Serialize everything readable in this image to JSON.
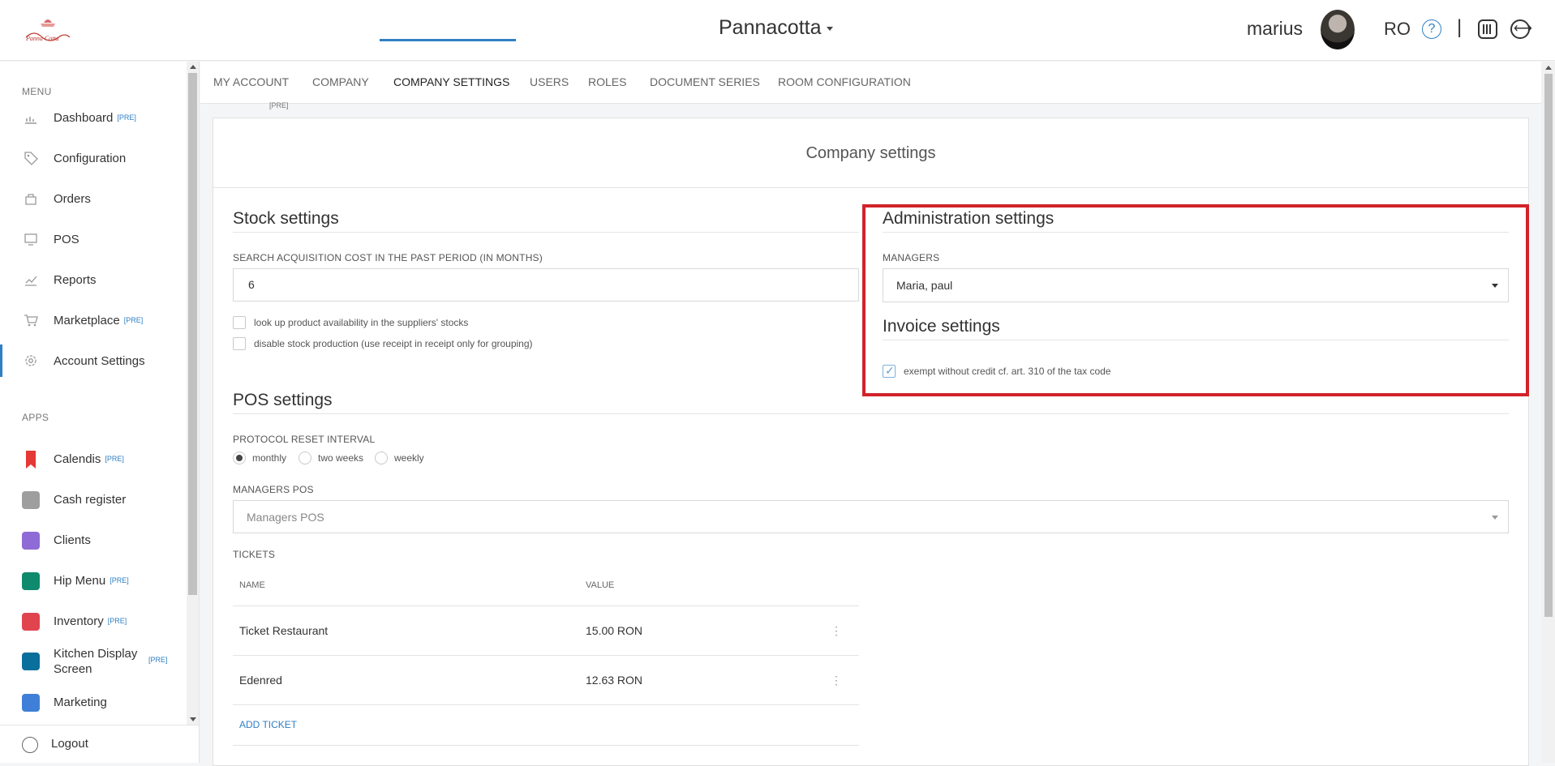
{
  "header": {
    "company": "Pannacotta",
    "username": "marius",
    "language": "RO",
    "help_glyph": "?",
    "separator": "|"
  },
  "sidebar": {
    "menu_title": "MENU",
    "apps_title": "APPS",
    "pre_badge": "[PRE]",
    "menu_items": [
      {
        "label": "Dashboard",
        "pre": true,
        "icon": "dashboard-icon"
      },
      {
        "label": "Configuration",
        "pre": false,
        "icon": "tag-icon"
      },
      {
        "label": "Orders",
        "pre": false,
        "icon": "orders-icon"
      },
      {
        "label": "POS",
        "pre": false,
        "icon": "pos-icon"
      },
      {
        "label": "Reports",
        "pre": false,
        "icon": "reports-icon"
      },
      {
        "label": "Marketplace",
        "pre": true,
        "icon": "cart-icon"
      },
      {
        "label": "Account Settings",
        "pre": false,
        "icon": "gear-icon"
      }
    ],
    "app_items": [
      {
        "label": "Calendis",
        "pre": true,
        "color": "#e53935"
      },
      {
        "label": "Cash register",
        "pre": false,
        "color": "#9e9e9e"
      },
      {
        "label": "Clients",
        "pre": false,
        "color": "#8e6bd6"
      },
      {
        "label": "Hip Menu",
        "pre": true,
        "color": "#0f8a6c"
      },
      {
        "label": "Inventory",
        "pre": true,
        "color": "#e0454f"
      },
      {
        "label": "Kitchen Display Screen",
        "pre": true,
        "color": "#0b6f9c"
      },
      {
        "label": "Marketing",
        "pre": false,
        "color": "#3f7fd8"
      }
    ],
    "logout": "Logout"
  },
  "tabs": {
    "items": [
      "MY ACCOUNT",
      "COMPANY",
      "COMPANY SETTINGS",
      "USERS",
      "ROLES",
      "DOCUMENT SERIES",
      "ROOM CONFIGURATION"
    ],
    "active": "COMPANY SETTINGS",
    "pre_badge": "[PRE]"
  },
  "card": {
    "title": "Company settings"
  },
  "stock": {
    "title": "Stock settings",
    "search_label": "SEARCH ACQUISITION COST IN THE PAST PERIOD (IN MONTHS)",
    "search_value": "6",
    "check_lookup": "look up product availability in the suppliers' stocks",
    "check_disable": "disable stock production (use receipt in receipt only for grouping)"
  },
  "admin": {
    "title": "Administration settings",
    "managers_label": "MANAGERS",
    "managers_value": "Maria, paul"
  },
  "invoice": {
    "title": "Invoice settings",
    "exempt_label": "exempt without credit cf. art. 310 of the tax code",
    "exempt_checked": true
  },
  "pos": {
    "title": "POS settings",
    "reset_label": "PROTOCOL RESET INTERVAL",
    "reset_options": [
      "monthly",
      "two weeks",
      "weekly"
    ],
    "reset_selected": "monthly",
    "managers_pos_label": "MANAGERS POS",
    "managers_pos_placeholder": "Managers POS",
    "tickets_label": "TICKETS",
    "tickets_columns": [
      "NAME",
      "VALUE"
    ],
    "tickets": [
      {
        "name": "Ticket Restaurant",
        "value": "15.00 RON"
      },
      {
        "name": "Edenred",
        "value": "12.63 RON"
      }
    ],
    "add_ticket": "ADD TICKET"
  },
  "colors": {
    "accent": "#2f7fc4",
    "highlight": "#d1232a"
  }
}
